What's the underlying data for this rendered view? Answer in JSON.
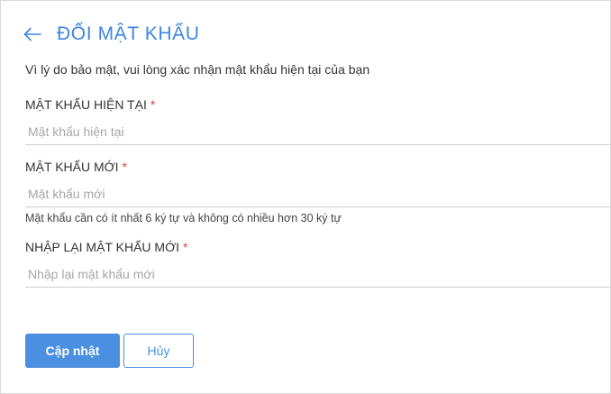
{
  "header": {
    "title": "ĐỔI MẬT KHẨU",
    "back_icon": "arrow-left-icon"
  },
  "description": "Vì lý do bảo mật, vui lòng xác nhận mật khẩu hiện tại của bạn",
  "fields": {
    "current": {
      "label": "MẬT KHẨU HIỆN TẠI",
      "required_mark": "*",
      "placeholder": "Mật khẩu hiện tại",
      "value": ""
    },
    "new": {
      "label": "MẬT KHẨU MỚI",
      "required_mark": "*",
      "placeholder": "Mật khẩu mới",
      "value": "",
      "hint": "Mật khẩu cần có ít nhất 6 ký tự và không có nhiều hơn 30 ký tự"
    },
    "confirm": {
      "label": "NHẬP LẠI MẬT KHẨU MỚI",
      "required_mark": "*",
      "placeholder": "Nhập lại mật khẩu mới",
      "value": ""
    }
  },
  "buttons": {
    "submit": "Cập nhật",
    "cancel": "Hủy"
  },
  "colors": {
    "accent": "#3d86e0",
    "primary_button": "#4a8fe0",
    "required": "#e03c3c"
  }
}
